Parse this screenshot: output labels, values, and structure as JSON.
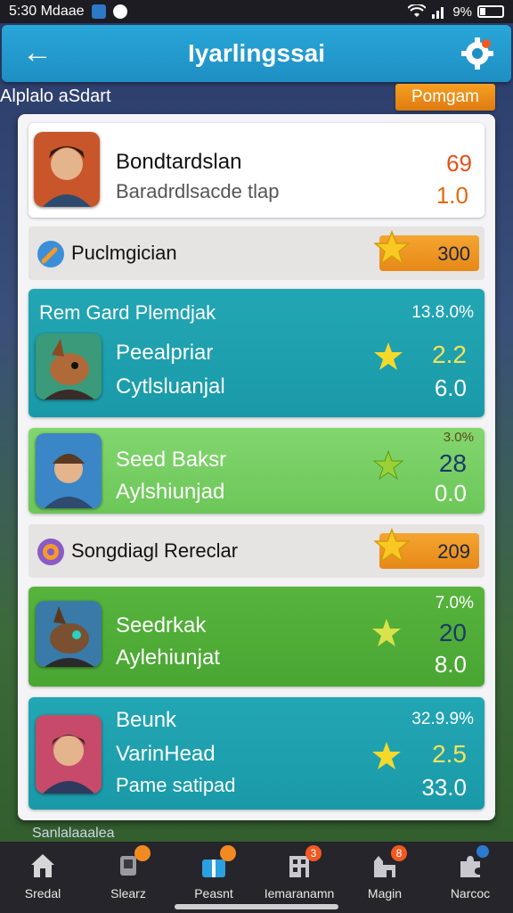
{
  "status_bar": {
    "time": "5:30 Mdaae",
    "battery_pct": "9%"
  },
  "app_bar": {
    "title": "Iyarlingssai"
  },
  "sub_header": {
    "subtitle": "Alplalo aSdart",
    "program_button": "Pomgam"
  },
  "profile": {
    "name": "Bondtardslan",
    "description": "Baradrdlsacde tlap",
    "value_top": "69",
    "value_bottom": "1.0"
  },
  "sections": [
    {
      "label": "Puclmgician",
      "score": "300"
    },
    {
      "label": "Songdiagl Rereclar",
      "score": "209"
    }
  ],
  "cards": [
    {
      "header": "Rem Gard Plemdjak",
      "pct": "13.8.0%",
      "line1": "Peealpriar",
      "line2": "Cytlsluanjal",
      "num1": "2.2",
      "num2": "6.0",
      "color": "teal",
      "num1_color": "#f2e35a"
    },
    {
      "pct": "3.0%",
      "line1": "Seed Baksr",
      "line2": "Aylshiunjad",
      "num1": "28",
      "num2": "0.0",
      "color": "lime",
      "num1_color": "#1b3a6a"
    },
    {
      "pct": "7.0%",
      "line1": "Seedrkak",
      "line2": "Aylehiunjat",
      "num1": "20",
      "num2": "8.0",
      "color": "green",
      "num1_color": "#1b3a6a"
    },
    {
      "line1": "Beunk",
      "line2": "VarinHead",
      "line3": "Pame satipad",
      "pct": "32.9.9%",
      "num1": "2.5",
      "num2": "33.0",
      "color": "teal",
      "num1_color": "#f2e35a"
    }
  ],
  "peek_text": "Sanlalaaalea",
  "bottom_nav": [
    {
      "label": "Sredal",
      "icon": "home-icon"
    },
    {
      "label": "Slearz",
      "icon": "trophy-icon",
      "badge": ""
    },
    {
      "label": "Peasnt",
      "icon": "gift-box-icon",
      "badge": ""
    },
    {
      "label": "Iemaranamn",
      "icon": "building-icon",
      "badge": "3"
    },
    {
      "label": "Magin",
      "icon": "castle-icon",
      "badge": "8"
    },
    {
      "label": "Narcoc",
      "icon": "puzzle-icon"
    }
  ],
  "colors": {
    "accent_blue": "#1e8fc3",
    "orange": "#e68818",
    "teal": "#1a9aa8"
  }
}
